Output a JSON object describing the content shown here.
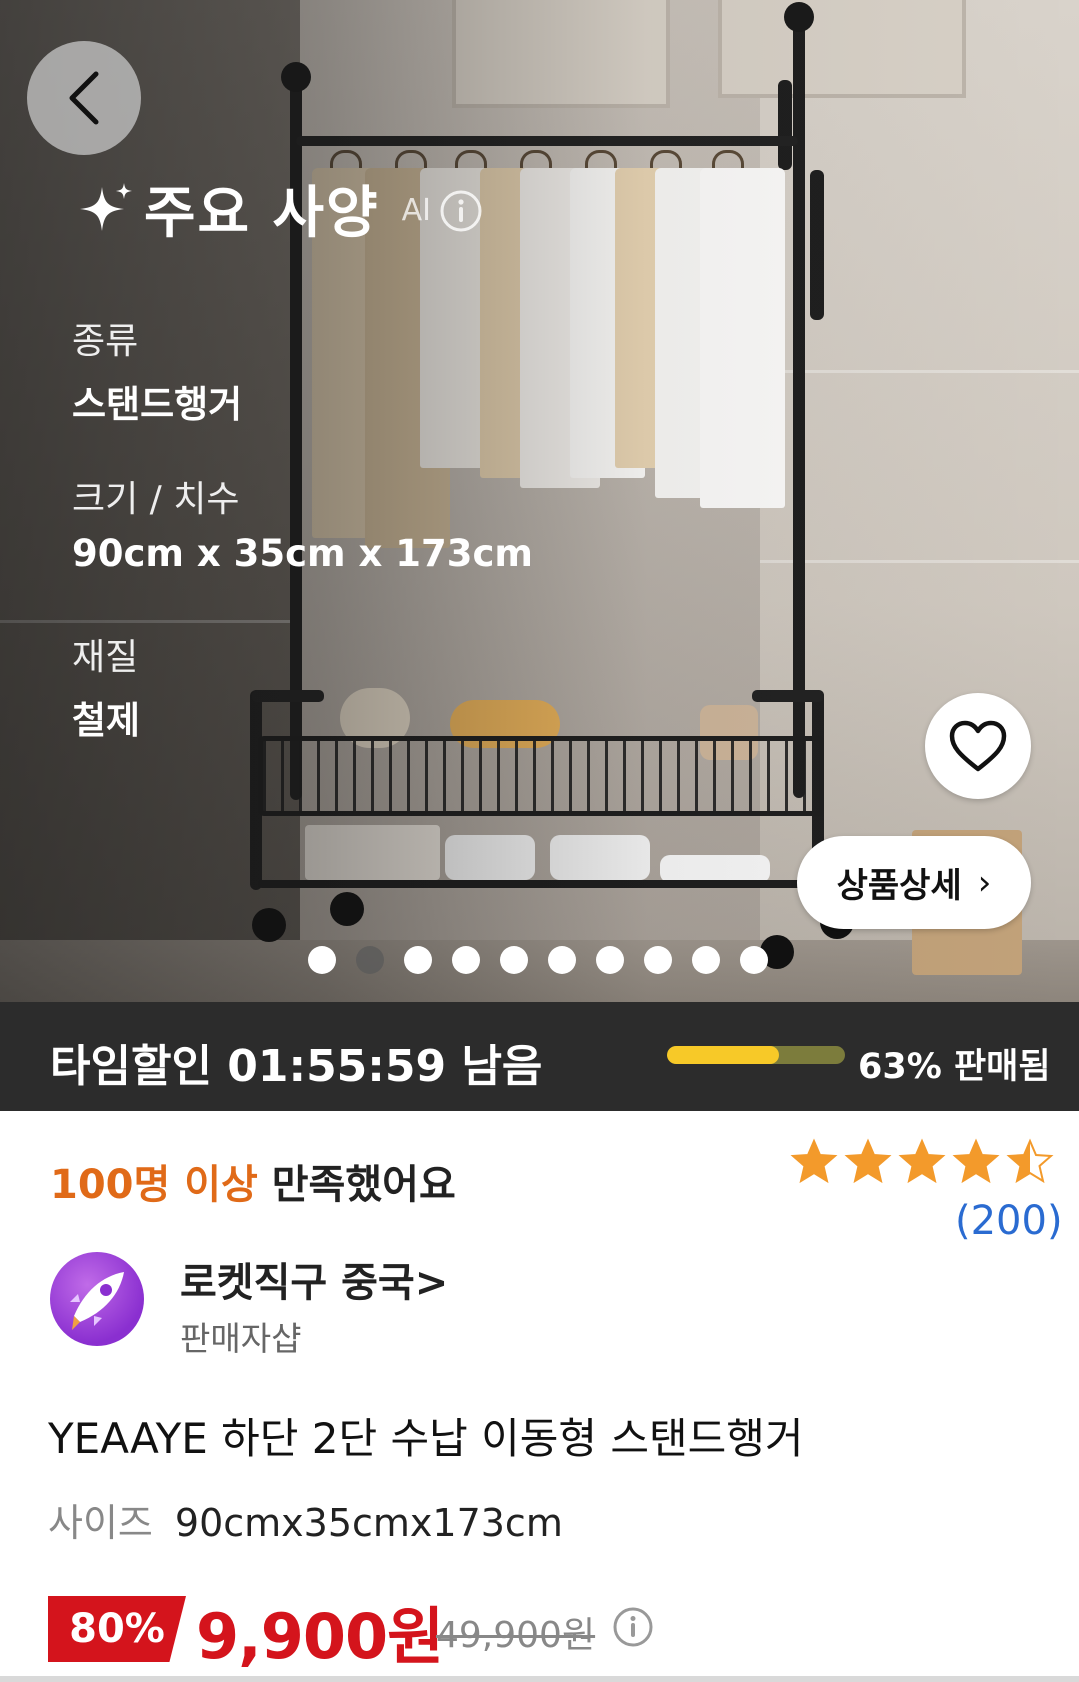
{
  "hero": {
    "spec_title": "주요 사양",
    "ai_badge": "AI",
    "specs": [
      {
        "label": "종류",
        "value": "스탠드행거"
      },
      {
        "label": "크기 / 치수",
        "value": "90cm x 35cm x 173cm"
      },
      {
        "label": "재질",
        "value": "철제"
      }
    ],
    "detail_button": "상품상세",
    "carousel": {
      "total": 10,
      "active_index": 1
    }
  },
  "timesale": {
    "label": "타임할인 01:55:59 남음",
    "progress_percent": 63,
    "sold_text": "63% 판매됨",
    "colors": {
      "fill": "#f7c928",
      "track": "#7c7c3c",
      "background": "#2c2c2c"
    }
  },
  "satisfaction": {
    "highlight": "100명 이상",
    "rest": " 만족했어요"
  },
  "rating": {
    "stars": 4.5,
    "count": "(200)"
  },
  "seller": {
    "name": "로켓직구 중국",
    "chevron": ">",
    "sub": "판매자샵"
  },
  "product": {
    "name": "YEAAYE 하단 2단 수납 이동형 스탠드행거",
    "size_label": "사이즈",
    "size_value": "90cmx35cmx173cm"
  },
  "price": {
    "discount": "80%",
    "sale_price": "9,900원",
    "original_price": "49,900원",
    "colors": {
      "sale": "#d4141c",
      "satisfy_highlight": "#e06a18",
      "rating_count": "#2a6bd1",
      "star": "#f39a2b"
    }
  }
}
